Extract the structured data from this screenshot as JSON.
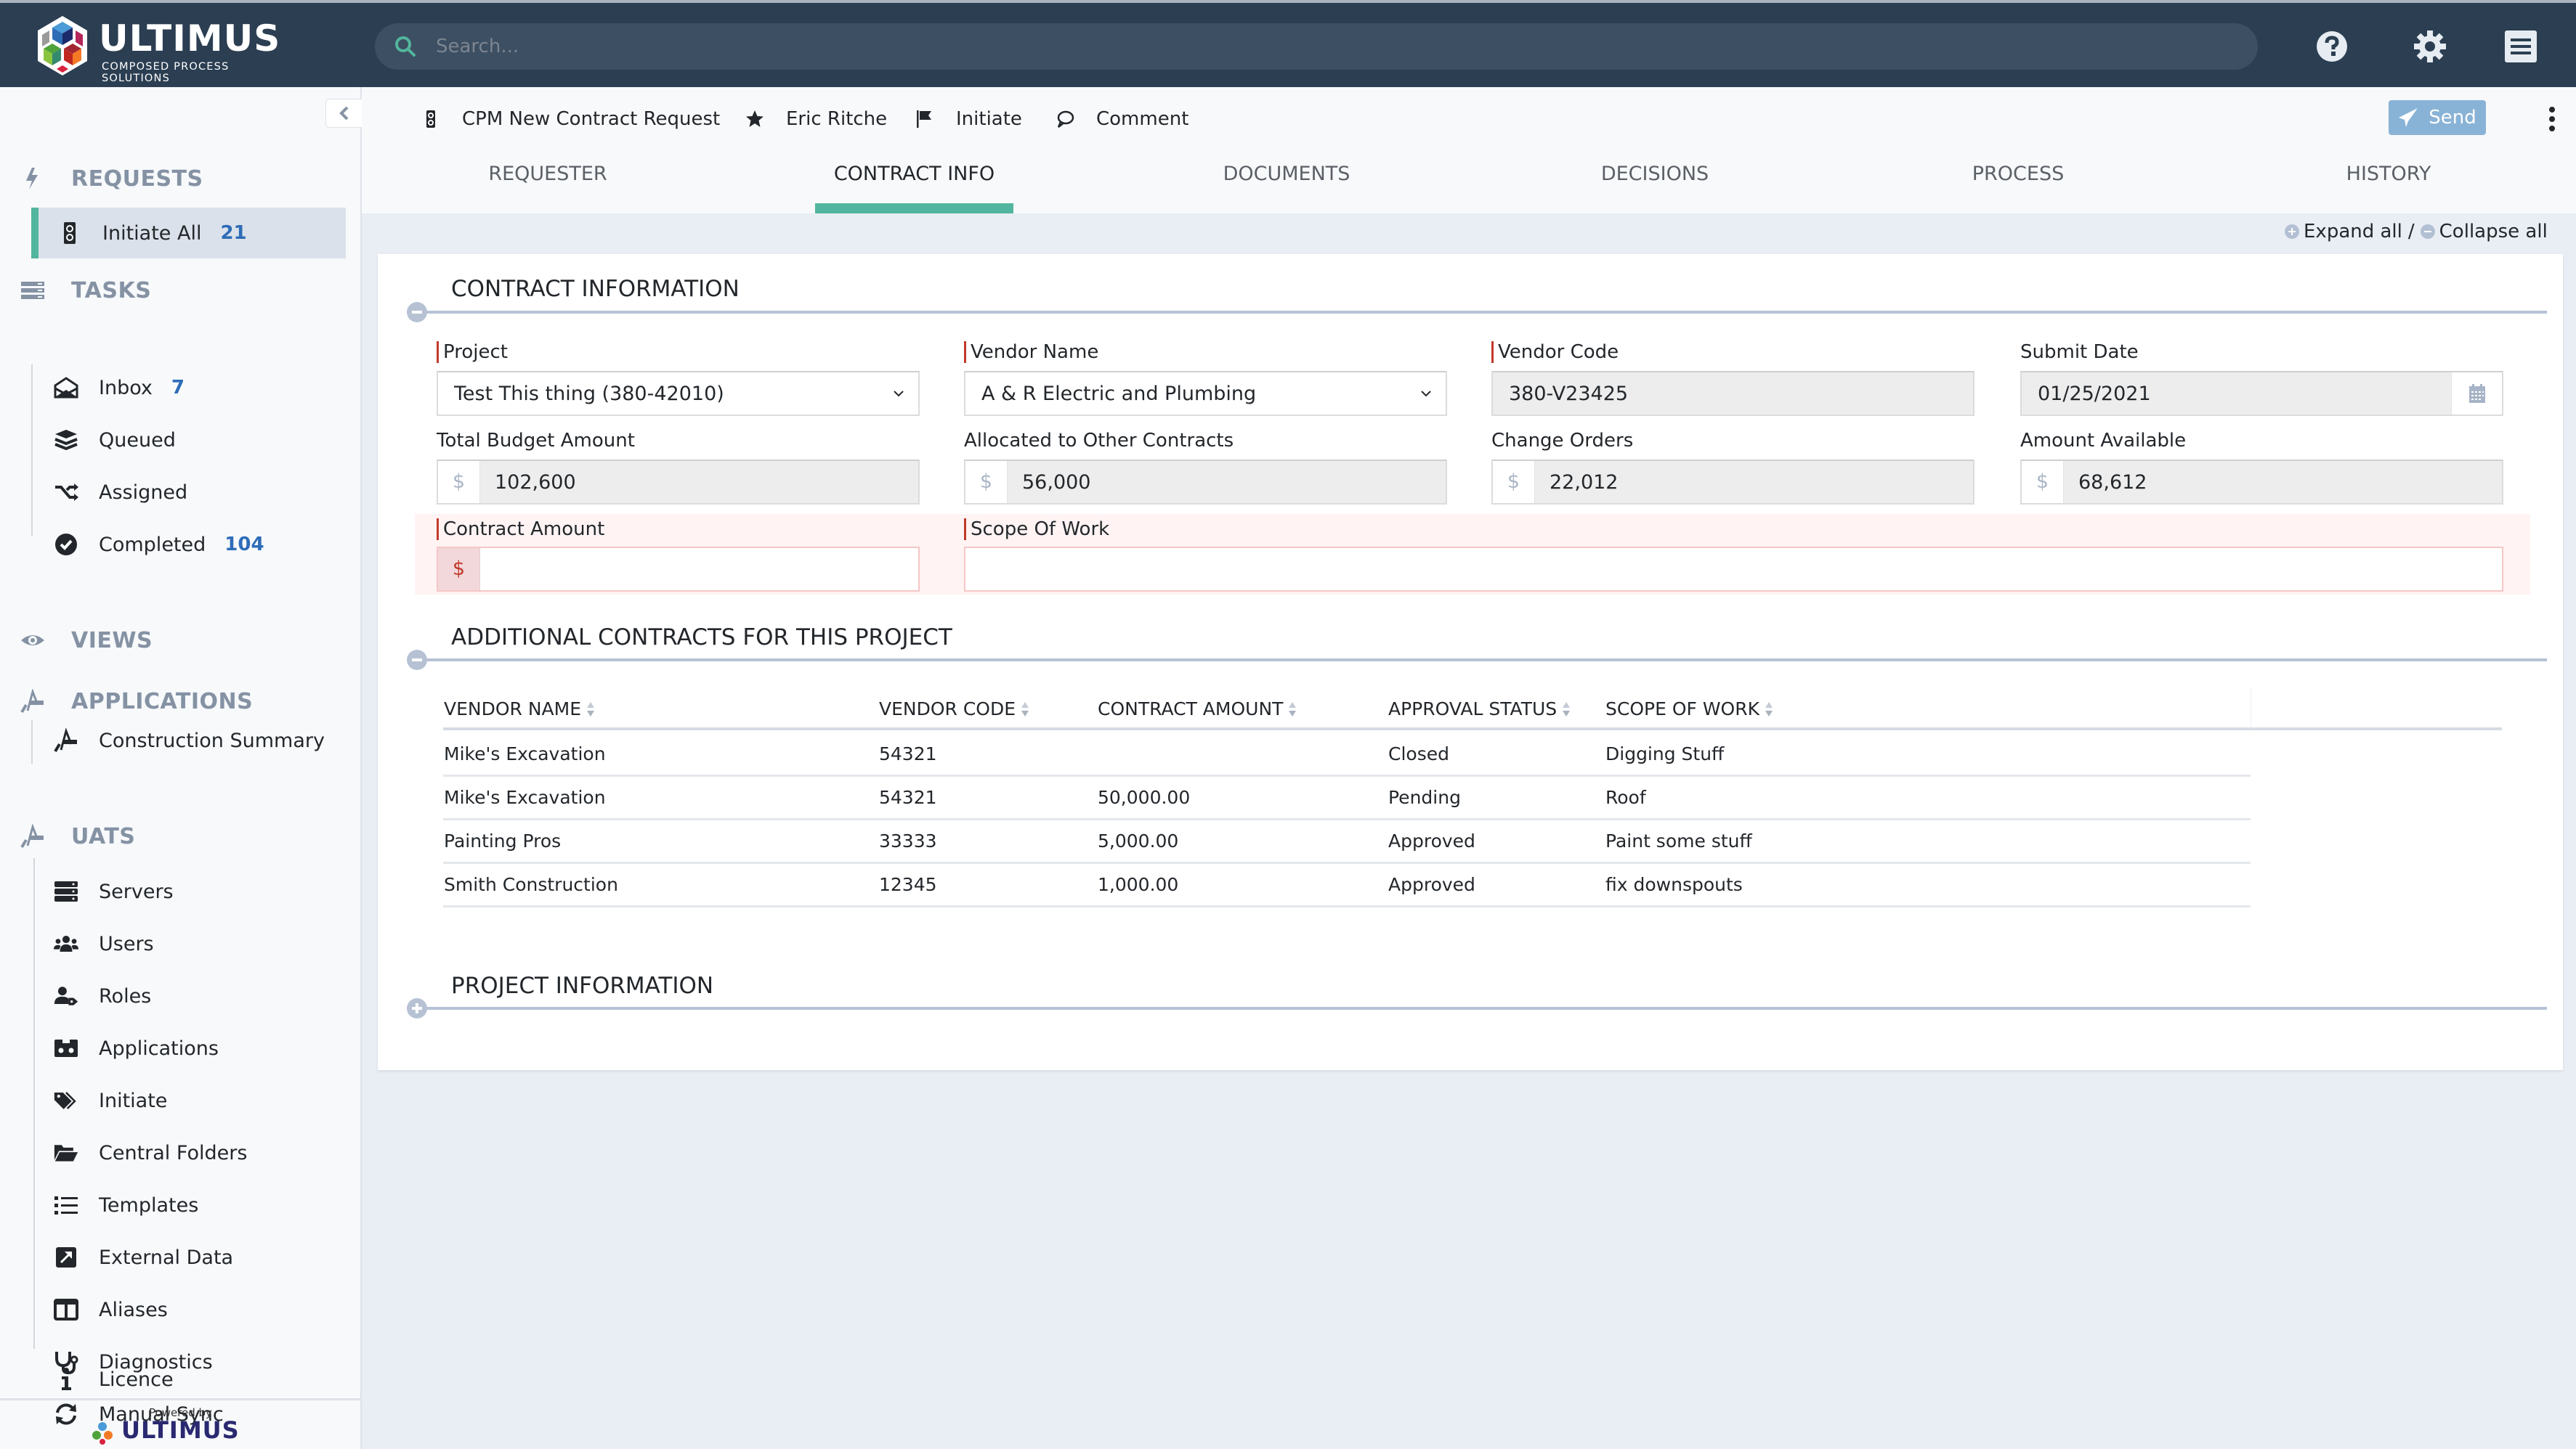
{
  "header": {
    "brand": "ULTIMUS",
    "tagline": "COMPOSED PROCESS SOLUTIONS",
    "search_placeholder": "Search..."
  },
  "sidebar": {
    "sections": [
      {
        "title": "REQUESTS",
        "icon": "bolt-icon",
        "items": [
          {
            "label": "Initiate All",
            "count": "21",
            "icon": "traffic-light-icon",
            "active": true
          }
        ]
      },
      {
        "title": "TASKS",
        "icon": "tasks-icon",
        "items": [
          {
            "label": "Inbox",
            "count": "7",
            "icon": "envelope-open-icon"
          },
          {
            "label": "Queued",
            "count": "",
            "icon": "layers-icon"
          },
          {
            "label": "Assigned",
            "count": "",
            "icon": "shuffle-icon"
          },
          {
            "label": "Completed",
            "count": "104",
            "icon": "check-circle-icon"
          }
        ]
      },
      {
        "title": "VIEWS",
        "icon": "eye-icon",
        "items": []
      },
      {
        "title": "APPLICATIONS",
        "icon": "drafting-icon",
        "items": [
          {
            "label": "Construction Summary",
            "icon": "drafting-icon"
          }
        ]
      },
      {
        "title": "UATS",
        "icon": "drafting-icon",
        "items": [
          {
            "label": "Servers",
            "icon": "server-icon"
          },
          {
            "label": "Users",
            "icon": "users-icon"
          },
          {
            "label": "Roles",
            "icon": "user-tag-icon"
          },
          {
            "label": "Applications",
            "icon": "app-icon"
          },
          {
            "label": "Initiate",
            "icon": "tags-icon"
          },
          {
            "label": "Central Folders",
            "icon": "folder-open-icon"
          },
          {
            "label": "Templates",
            "icon": "list-icon"
          },
          {
            "label": "External Data",
            "icon": "external-link-icon"
          },
          {
            "label": "Aliases",
            "icon": "columns-icon"
          },
          {
            "label": "Diagnostics",
            "icon": "stethoscope-icon"
          },
          {
            "label": "Manual Sync",
            "icon": "sync-icon"
          },
          {
            "label": "Licence",
            "icon": "info-icon"
          }
        ]
      }
    ],
    "powered_by": "Powered by",
    "powered_brand": "ULTIMUS"
  },
  "actionbar": {
    "process": "CPM New Contract Request",
    "user": "Eric Ritche",
    "step": "Initiate",
    "comment": "Comment",
    "send": "Send"
  },
  "tabs": [
    {
      "label": "REQUESTER"
    },
    {
      "label": "CONTRACT INFO",
      "active": true
    },
    {
      "label": "DOCUMENTS"
    },
    {
      "label": "DECISIONS"
    },
    {
      "label": "PROCESS"
    },
    {
      "label": "HISTORY"
    }
  ],
  "expand_all": "Expand all",
  "expand_sep": "/",
  "collapse_all": "Collapse all",
  "contract_info": {
    "title": "CONTRACT INFORMATION",
    "fields": {
      "project": {
        "label": "Project",
        "value": "Test This thing (380-42010)"
      },
      "vendor_name": {
        "label": "Vendor Name",
        "value": "A & R Electric and Plumbing"
      },
      "vendor_code": {
        "label": "Vendor Code",
        "value": "380-V23425"
      },
      "submit_date": {
        "label": "Submit Date",
        "value": "01/25/2021"
      },
      "total_budget": {
        "label": "Total Budget Amount",
        "prefix": "$",
        "value": "102,600"
      },
      "allocated": {
        "label": "Allocated to Other Contracts",
        "prefix": "$",
        "value": "56,000"
      },
      "change_orders": {
        "label": "Change Orders",
        "prefix": "$",
        "value": "22,012"
      },
      "amount_available": {
        "label": "Amount Available",
        "prefix": "$",
        "value": "68,612"
      },
      "contract_amount": {
        "label": "Contract Amount",
        "prefix": "$",
        "value": ""
      },
      "scope_of_work": {
        "label": "Scope Of Work",
        "value": ""
      }
    }
  },
  "additional_contracts": {
    "title": "ADDITIONAL CONTRACTS FOR THIS PROJECT",
    "columns": [
      "VENDOR NAME",
      "VENDOR CODE",
      "CONTRACT AMOUNT",
      "APPROVAL STATUS",
      "SCOPE OF WORK"
    ],
    "rows": [
      [
        "Mike's Excavation",
        "54321",
        "",
        "Closed",
        "Digging Stuff"
      ],
      [
        "Mike's Excavation",
        "54321",
        "50,000.00",
        "Pending",
        "Roof"
      ],
      [
        "Painting Pros",
        "33333",
        "5,000.00",
        "Approved",
        "Paint some stuff"
      ],
      [
        "Smith Construction",
        "12345",
        "1,000.00",
        "Approved",
        "fix downspouts"
      ]
    ]
  },
  "project_info": {
    "title": "PROJECT INFORMATION"
  },
  "colors": {
    "header_bg": "#2b3e52",
    "accent": "#52b59d",
    "count": "#2f6cb8",
    "send": "#89b3d6",
    "required": "#c0392b"
  }
}
